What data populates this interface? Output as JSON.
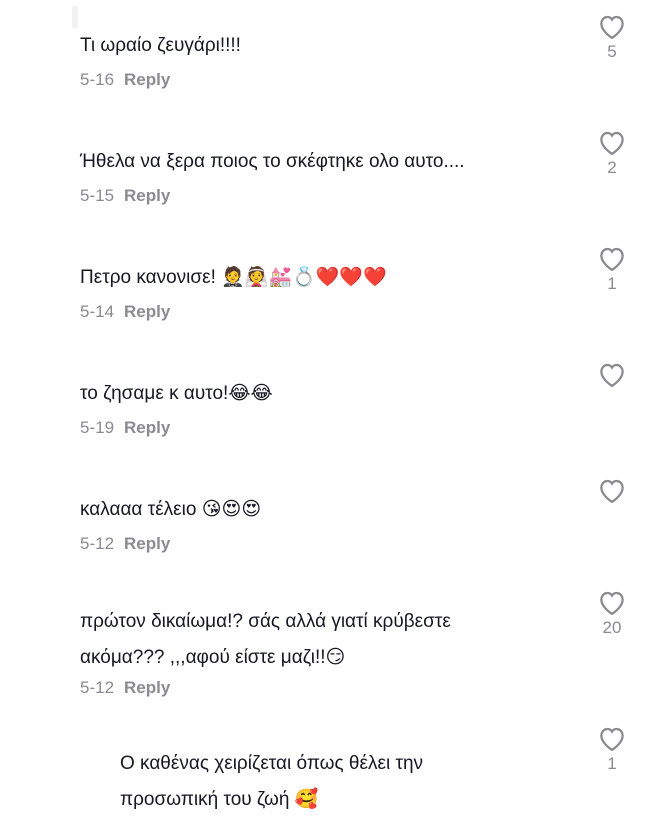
{
  "comments": [
    {
      "text": "Τι ωραίο ζευγάρι!!!!",
      "date": "5-16",
      "reply": "Reply",
      "likes": "5"
    },
    {
      "text": "Ήθελα να ξερα ποιος το σκέφτηκε ολο αυτο....",
      "date": "5-15",
      "reply": "Reply",
      "likes": "2"
    },
    {
      "text": "Πετρο κανονισε! 🤵👰💒💍❤️❤️❤️",
      "date": "5-14",
      "reply": "Reply",
      "likes": "1"
    },
    {
      "text": "το ζησαμε κ αυτο!😂😂",
      "date": "5-19",
      "reply": "Reply",
      "likes": ""
    },
    {
      "text": "καλααα τέλειο 😘😍😍",
      "date": "5-12",
      "reply": "Reply",
      "likes": ""
    },
    {
      "text_line1": "πρώτον δικαίωμα!? σάς αλλά γιατί κρύβεστε",
      "text_line2": "ακόμα??? ,,,αφού είστε μαζι!!😏",
      "date": "5-12",
      "reply": "Reply",
      "likes": "20"
    }
  ],
  "reply_comment": {
    "text_line1": "Ο καθένας χειρίζεται όπως θέλει την",
    "text_line2": "προσωπική του ζωή 🥰",
    "likes": "1"
  },
  "icons": {
    "like": "heart-outline-icon"
  },
  "colors": {
    "text": "#161823",
    "secondary": "#8a8b91"
  }
}
